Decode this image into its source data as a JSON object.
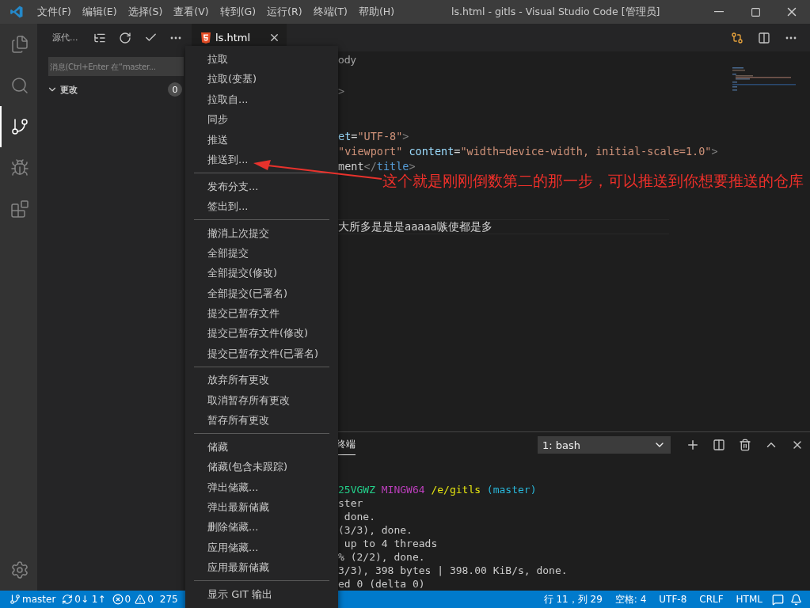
{
  "window": {
    "title": "ls.html - gitls - Visual Studio Code [管理员]"
  },
  "menu_bar": [
    "文件(F)",
    "编辑(E)",
    "选择(S)",
    "查看(V)",
    "转到(G)",
    "运行(R)",
    "终端(T)",
    "帮助(H)"
  ],
  "activity_bar": [
    {
      "kind": "explorer",
      "selected": false
    },
    {
      "kind": "search",
      "selected": false
    },
    {
      "kind": "scm",
      "selected": true
    },
    {
      "kind": "debug",
      "selected": false
    },
    {
      "kind": "extensions",
      "selected": false
    }
  ],
  "sidebar": {
    "title": "源代...",
    "message": {
      "placeholder": "消息(Ctrl+Enter 在“master..."
    },
    "section": {
      "label": "更改",
      "count": "0",
      "expanded": true
    }
  },
  "tabs": [
    {
      "label": "ls.html",
      "selected": true
    }
  ],
  "editor": {
    "breadcrumb": "ody",
    "line_groups": [
      {
        "lines": [
          {
            "tokens": [
              {
                "text": ">"
              }
            ]
          }
        ]
      },
      {
        "lines": [
          {
            "tokens": [
              {
                "text": "et",
                "color": "#9cdcfe"
              },
              {
                "text": "=",
                "color": "#d4d4d4"
              },
              {
                "text": "\"UTF-8\"",
                "color": "#ce9178"
              },
              {
                "text": ">",
                "color": "#808080"
              }
            ]
          },
          {
            "tokens": [
              {
                "text": "\"viewport\"",
                "color": "#ce9178"
              },
              {
                "text": " content",
                "color": "#9cdcfe"
              },
              {
                "text": "=",
                "color": "#d4d4d4"
              },
              {
                "text": "\"width=device-width, initial-scale=1.0\"",
                "color": "#ce9178"
              },
              {
                "text": ">",
                "color": "#808080"
              }
            ]
          },
          {
            "tokens": [
              {
                "text": "ment",
                "color": "#d4d4d4"
              },
              {
                "text": "</",
                "color": "#808080"
              },
              {
                "text": "title",
                "color": "#569cd6"
              },
              {
                "text": ">",
                "color": "#808080"
              }
            ]
          }
        ]
      },
      {
        "lines": [
          {
            "current": true,
            "tokens": [
              {
                "text": "大所多是是是aaaaa嗾使都是多",
                "color": "#d4d4d4"
              }
            ]
          }
        ]
      }
    ]
  },
  "context_menu": {
    "groups": [
      {
        "items": [
          "拉取",
          "拉取(变基)",
          "拉取自...",
          "同步",
          "推送",
          "推送到..."
        ]
      },
      {
        "items": [
          "发布分支...",
          "签出到..."
        ]
      },
      {
        "items": [
          "撤消上次提交",
          "全部提交",
          "全部提交(修改)",
          "全部提交(已署名)",
          "提交已暂存文件",
          "提交已暂存文件(修改)",
          "提交已暂存文件(已署名)"
        ]
      },
      {
        "items": [
          "放弃所有更改",
          "取消暂存所有更改",
          "暂存所有更改"
        ]
      },
      {
        "items": [
          "储藏",
          "储藏(包含未跟踪)",
          "弹出储藏...",
          "弹出最新储藏",
          "删除储藏...",
          "应用储藏...",
          "应用最新储藏"
        ]
      },
      {
        "items": [
          "显示 GIT 输出"
        ]
      }
    ]
  },
  "annotation": {
    "text": "这个就是刚刚倒数第二的那一步，可以推送到你想要推送的仓库"
  },
  "panel": {
    "tabs": [
      {
        "label": "终端",
        "selected": true
      }
    ],
    "terminal_select": "1: bash",
    "lines": [
      {
        "tokens": [
          {
            "text": "25VGWZ",
            "color": "#23d18b"
          },
          {
            "text": " MINGW64",
            "color": "#bc3fbc"
          },
          {
            "text": " /e/gitls",
            "color": "#e5e510"
          },
          {
            "text": " (master)",
            "color": "#29b8db"
          }
        ]
      },
      {
        "tokens": [
          {
            "text": "ster",
            "color": "#cccccc"
          }
        ]
      },
      {
        "tokens": [
          {
            "text": " done.",
            "color": "#cccccc"
          }
        ]
      },
      {
        "tokens": [
          {
            "text": "(3/3), done.",
            "color": "#cccccc"
          }
        ]
      },
      {
        "tokens": [
          {
            "text": " up to 4 threads",
            "color": "#cccccc"
          }
        ]
      },
      {
        "tokens": [
          {
            "text": "% (2/2), done.",
            "color": "#cccccc"
          }
        ]
      },
      {
        "tokens": [
          {
            "text": "3/3), 398 bytes | 398.00 KiB/s, done.",
            "color": "#cccccc"
          }
        ]
      },
      {
        "tokens": [
          {
            "text": "ed 0 (delta 0)",
            "color": "#cccccc"
          }
        ]
      }
    ]
  },
  "status_bar": {
    "left": [
      {
        "kind": "branch",
        "text": "master"
      },
      {
        "kind": "sync",
        "text": "0↓ 1↑"
      },
      {
        "kind": "problems",
        "errors": "0",
        "warnings": "0"
      },
      {
        "kind": "text",
        "text": "275"
      }
    ],
    "right": [
      "行 11，列 29",
      "空格: 4",
      "UTF-8",
      "CRLF",
      "HTML"
    ]
  }
}
